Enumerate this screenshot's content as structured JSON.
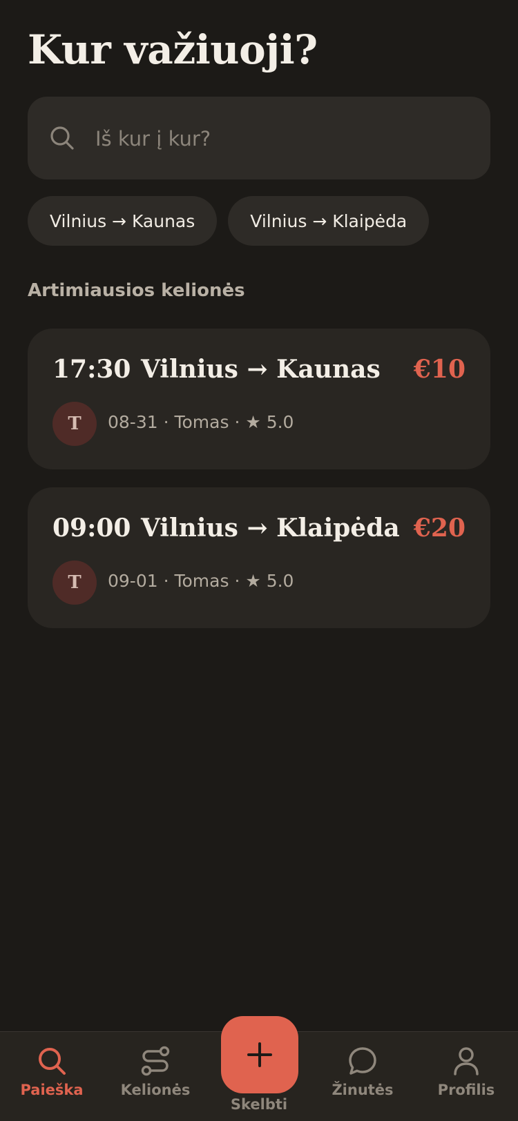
{
  "header": {
    "title": "Kur važiuoji?"
  },
  "search": {
    "placeholder": "Iš kur į kur?",
    "icon": "search-icon"
  },
  "quick_routes": [
    {
      "label": "Vilnius → Kaunas"
    },
    {
      "label": "Vilnius → Klaipėda"
    }
  ],
  "section": {
    "title": "Artimiausios kelionės"
  },
  "trips": [
    {
      "time": "17:30",
      "route": "Vilnius → Kaunas",
      "price": "€10",
      "avatar_initial": "T",
      "meta": "08-31 · Tomas · ★ 5.0"
    },
    {
      "time": "09:00",
      "route": "Vilnius → Klaipėda",
      "price": "€20",
      "avatar_initial": "T",
      "meta": "09-01 · Tomas · ★ 5.0"
    }
  ],
  "nav": {
    "search": {
      "label": "Paieška",
      "icon": "search-icon"
    },
    "trips": {
      "label": "Kelionės",
      "icon": "route-icon"
    },
    "publish": {
      "label": "Skelbti",
      "icon": "plus-icon"
    },
    "messages": {
      "label": "Žinutės",
      "icon": "chat-bubble-icon"
    },
    "profile": {
      "label": "Profilis",
      "icon": "user-icon"
    }
  },
  "colors": {
    "background": "#1c1a17",
    "surface": "#2e2b27",
    "card": "#292622",
    "accent": "#e0634f",
    "text": "#f3eee6",
    "muted": "#8f877c"
  }
}
